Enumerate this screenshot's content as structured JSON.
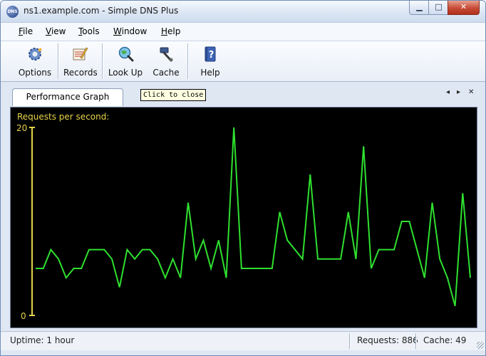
{
  "window": {
    "title": "ns1.example.com - Simple DNS Plus",
    "icon_label": "DNS",
    "min_glyph": "▁",
    "max_glyph": "□",
    "close_glyph": "✕"
  },
  "menu": {
    "items": [
      {
        "underline": "F",
        "rest": "ile"
      },
      {
        "underline": "V",
        "rest": "iew"
      },
      {
        "underline": "T",
        "rest": "ools"
      },
      {
        "underline": "W",
        "rest": "indow"
      },
      {
        "underline": "H",
        "rest": "elp"
      }
    ]
  },
  "toolbar": {
    "options": {
      "label": "Options",
      "icon": "gear-icon"
    },
    "records": {
      "label": "Records",
      "icon": "records-icon"
    },
    "lookup": {
      "label": "Look Up",
      "icon": "magnifier-globe-icon"
    },
    "cache": {
      "label": "Cache",
      "icon": "hammer-icon"
    },
    "help": {
      "label": "Help",
      "icon": "help-book-icon"
    }
  },
  "tabs": {
    "active_label": "Performance Graph",
    "tooltip": "Click to close",
    "prev_glyph": "◂",
    "next_glyph": "▸",
    "close_glyph": "✕"
  },
  "status": {
    "uptime": "Uptime: 1 hour",
    "requests": "Requests: 886",
    "cache": "Cache: 49"
  },
  "chart_data": {
    "type": "line",
    "title": "Requests per second:",
    "ylim": [
      0,
      20
    ],
    "yticks": [
      "20",
      "0"
    ],
    "axis_color": "#e6d24a",
    "line_color": "#2fe02f",
    "background": "#000000",
    "grid": false,
    "series": [
      {
        "values": [
          5,
          5,
          7,
          6,
          4,
          5,
          5,
          7,
          7,
          7,
          6,
          3,
          7,
          6,
          7,
          7,
          6,
          4,
          6,
          4,
          12,
          6,
          8,
          5,
          8,
          4,
          20,
          5,
          5,
          5,
          5,
          5,
          11,
          8,
          7,
          6,
          15,
          6,
          6,
          6,
          6,
          11,
          6,
          18,
          5,
          7,
          7,
          7,
          10,
          10,
          7,
          4,
          12,
          6,
          4,
          1,
          13,
          4
        ]
      }
    ]
  }
}
